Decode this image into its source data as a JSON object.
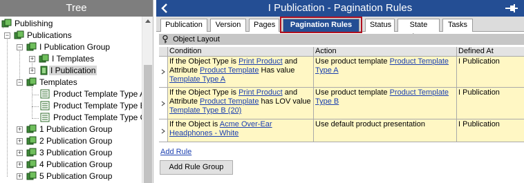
{
  "tree": {
    "title": "Tree",
    "nodes": [
      {
        "label": "Publishing"
      },
      {
        "label": "Publications"
      },
      {
        "label": "I Publication Group"
      },
      {
        "label": "I Templates"
      },
      {
        "label": "I Publication"
      },
      {
        "label": "Templates"
      },
      {
        "label": "Product Template Type A"
      },
      {
        "label": "Product Template Type B"
      },
      {
        "label": "Product Template Type C"
      },
      {
        "label": "1 Publication Group"
      },
      {
        "label": "2 Publication Group"
      },
      {
        "label": "3 Publication Group"
      },
      {
        "label": "4 Publication Group"
      },
      {
        "label": "5 Publication Group"
      }
    ]
  },
  "header": {
    "title": "I Publication - Pagination Rules"
  },
  "tabs": [
    {
      "label": "Publication"
    },
    {
      "label": "Version"
    },
    {
      "label": "Pages"
    },
    {
      "label": "Pagination Rules"
    },
    {
      "label": "Status"
    },
    {
      "label": "State Log"
    },
    {
      "label": "Tasks"
    }
  ],
  "section": {
    "title": "Object Layout"
  },
  "grid": {
    "columns": [
      "Condition",
      "Action",
      "Defined At"
    ],
    "rows": [
      {
        "cond_1": "If the Object Type is ",
        "cond_link_1": "Print Product",
        "cond_2": " and Attribute ",
        "cond_link_2": "Product Template",
        "cond_3": " Has value ",
        "cond_link_3": "Template Type A",
        "action_text": "Use product template ",
        "action_link": "Product Template Type A",
        "defined_at": "I Publication"
      },
      {
        "cond_1": "If the Object Type is ",
        "cond_link_1": "Print Product",
        "cond_2": " and Attribute ",
        "cond_link_2": "Product Template",
        "cond_3": " has LOV value ",
        "cond_link_3": "Template Type B (20)",
        "action_text": "Use product template ",
        "action_link": "Product Template Type B",
        "defined_at": "I Publication"
      },
      {
        "cond_1": "If the Object is ",
        "cond_link_1": "Acme Over-Ear Headphones - White",
        "action_text": "Use default product presentation",
        "defined_at": "I Publication"
      }
    ]
  },
  "actions": {
    "add_rule": "Add Rule",
    "add_rule_group": "Add Rule Group"
  },
  "colors": {
    "title_bar": "#244e94",
    "active_tab": "#244e94",
    "highlight": "#b0101e",
    "row_fill": "#fff7c4",
    "link": "#1a3fb0"
  }
}
